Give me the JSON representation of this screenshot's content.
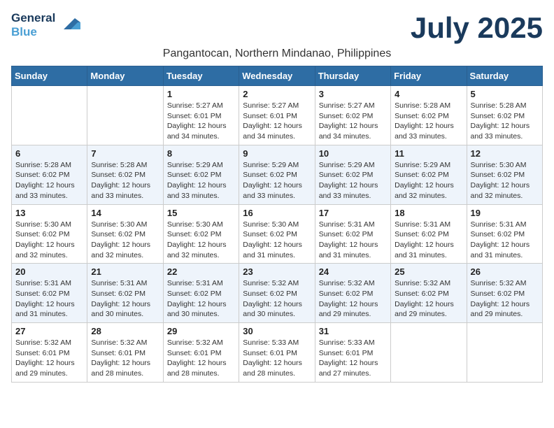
{
  "logo": {
    "line1": "General",
    "line2": "Blue"
  },
  "title": "July 2025",
  "location": "Pangantocan, Northern Mindanao, Philippines",
  "days_of_week": [
    "Sunday",
    "Monday",
    "Tuesday",
    "Wednesday",
    "Thursday",
    "Friday",
    "Saturday"
  ],
  "weeks": [
    [
      {
        "day": "",
        "sunrise": "",
        "sunset": "",
        "daylight": ""
      },
      {
        "day": "",
        "sunrise": "",
        "sunset": "",
        "daylight": ""
      },
      {
        "day": "1",
        "sunrise": "Sunrise: 5:27 AM",
        "sunset": "Sunset: 6:01 PM",
        "daylight": "Daylight: 12 hours and 34 minutes."
      },
      {
        "day": "2",
        "sunrise": "Sunrise: 5:27 AM",
        "sunset": "Sunset: 6:01 PM",
        "daylight": "Daylight: 12 hours and 34 minutes."
      },
      {
        "day": "3",
        "sunrise": "Sunrise: 5:27 AM",
        "sunset": "Sunset: 6:02 PM",
        "daylight": "Daylight: 12 hours and 34 minutes."
      },
      {
        "day": "4",
        "sunrise": "Sunrise: 5:28 AM",
        "sunset": "Sunset: 6:02 PM",
        "daylight": "Daylight: 12 hours and 33 minutes."
      },
      {
        "day": "5",
        "sunrise": "Sunrise: 5:28 AM",
        "sunset": "Sunset: 6:02 PM",
        "daylight": "Daylight: 12 hours and 33 minutes."
      }
    ],
    [
      {
        "day": "6",
        "sunrise": "Sunrise: 5:28 AM",
        "sunset": "Sunset: 6:02 PM",
        "daylight": "Daylight: 12 hours and 33 minutes."
      },
      {
        "day": "7",
        "sunrise": "Sunrise: 5:28 AM",
        "sunset": "Sunset: 6:02 PM",
        "daylight": "Daylight: 12 hours and 33 minutes."
      },
      {
        "day": "8",
        "sunrise": "Sunrise: 5:29 AM",
        "sunset": "Sunset: 6:02 PM",
        "daylight": "Daylight: 12 hours and 33 minutes."
      },
      {
        "day": "9",
        "sunrise": "Sunrise: 5:29 AM",
        "sunset": "Sunset: 6:02 PM",
        "daylight": "Daylight: 12 hours and 33 minutes."
      },
      {
        "day": "10",
        "sunrise": "Sunrise: 5:29 AM",
        "sunset": "Sunset: 6:02 PM",
        "daylight": "Daylight: 12 hours and 33 minutes."
      },
      {
        "day": "11",
        "sunrise": "Sunrise: 5:29 AM",
        "sunset": "Sunset: 6:02 PM",
        "daylight": "Daylight: 12 hours and 32 minutes."
      },
      {
        "day": "12",
        "sunrise": "Sunrise: 5:30 AM",
        "sunset": "Sunset: 6:02 PM",
        "daylight": "Daylight: 12 hours and 32 minutes."
      }
    ],
    [
      {
        "day": "13",
        "sunrise": "Sunrise: 5:30 AM",
        "sunset": "Sunset: 6:02 PM",
        "daylight": "Daylight: 12 hours and 32 minutes."
      },
      {
        "day": "14",
        "sunrise": "Sunrise: 5:30 AM",
        "sunset": "Sunset: 6:02 PM",
        "daylight": "Daylight: 12 hours and 32 minutes."
      },
      {
        "day": "15",
        "sunrise": "Sunrise: 5:30 AM",
        "sunset": "Sunset: 6:02 PM",
        "daylight": "Daylight: 12 hours and 32 minutes."
      },
      {
        "day": "16",
        "sunrise": "Sunrise: 5:30 AM",
        "sunset": "Sunset: 6:02 PM",
        "daylight": "Daylight: 12 hours and 31 minutes."
      },
      {
        "day": "17",
        "sunrise": "Sunrise: 5:31 AM",
        "sunset": "Sunset: 6:02 PM",
        "daylight": "Daylight: 12 hours and 31 minutes."
      },
      {
        "day": "18",
        "sunrise": "Sunrise: 5:31 AM",
        "sunset": "Sunset: 6:02 PM",
        "daylight": "Daylight: 12 hours and 31 minutes."
      },
      {
        "day": "19",
        "sunrise": "Sunrise: 5:31 AM",
        "sunset": "Sunset: 6:02 PM",
        "daylight": "Daylight: 12 hours and 31 minutes."
      }
    ],
    [
      {
        "day": "20",
        "sunrise": "Sunrise: 5:31 AM",
        "sunset": "Sunset: 6:02 PM",
        "daylight": "Daylight: 12 hours and 31 minutes."
      },
      {
        "day": "21",
        "sunrise": "Sunrise: 5:31 AM",
        "sunset": "Sunset: 6:02 PM",
        "daylight": "Daylight: 12 hours and 30 minutes."
      },
      {
        "day": "22",
        "sunrise": "Sunrise: 5:31 AM",
        "sunset": "Sunset: 6:02 PM",
        "daylight": "Daylight: 12 hours and 30 minutes."
      },
      {
        "day": "23",
        "sunrise": "Sunrise: 5:32 AM",
        "sunset": "Sunset: 6:02 PM",
        "daylight": "Daylight: 12 hours and 30 minutes."
      },
      {
        "day": "24",
        "sunrise": "Sunrise: 5:32 AM",
        "sunset": "Sunset: 6:02 PM",
        "daylight": "Daylight: 12 hours and 29 minutes."
      },
      {
        "day": "25",
        "sunrise": "Sunrise: 5:32 AM",
        "sunset": "Sunset: 6:02 PM",
        "daylight": "Daylight: 12 hours and 29 minutes."
      },
      {
        "day": "26",
        "sunrise": "Sunrise: 5:32 AM",
        "sunset": "Sunset: 6:02 PM",
        "daylight": "Daylight: 12 hours and 29 minutes."
      }
    ],
    [
      {
        "day": "27",
        "sunrise": "Sunrise: 5:32 AM",
        "sunset": "Sunset: 6:01 PM",
        "daylight": "Daylight: 12 hours and 29 minutes."
      },
      {
        "day": "28",
        "sunrise": "Sunrise: 5:32 AM",
        "sunset": "Sunset: 6:01 PM",
        "daylight": "Daylight: 12 hours and 28 minutes."
      },
      {
        "day": "29",
        "sunrise": "Sunrise: 5:32 AM",
        "sunset": "Sunset: 6:01 PM",
        "daylight": "Daylight: 12 hours and 28 minutes."
      },
      {
        "day": "30",
        "sunrise": "Sunrise: 5:33 AM",
        "sunset": "Sunset: 6:01 PM",
        "daylight": "Daylight: 12 hours and 28 minutes."
      },
      {
        "day": "31",
        "sunrise": "Sunrise: 5:33 AM",
        "sunset": "Sunset: 6:01 PM",
        "daylight": "Daylight: 12 hours and 27 minutes."
      },
      {
        "day": "",
        "sunrise": "",
        "sunset": "",
        "daylight": ""
      },
      {
        "day": "",
        "sunrise": "",
        "sunset": "",
        "daylight": ""
      }
    ]
  ]
}
